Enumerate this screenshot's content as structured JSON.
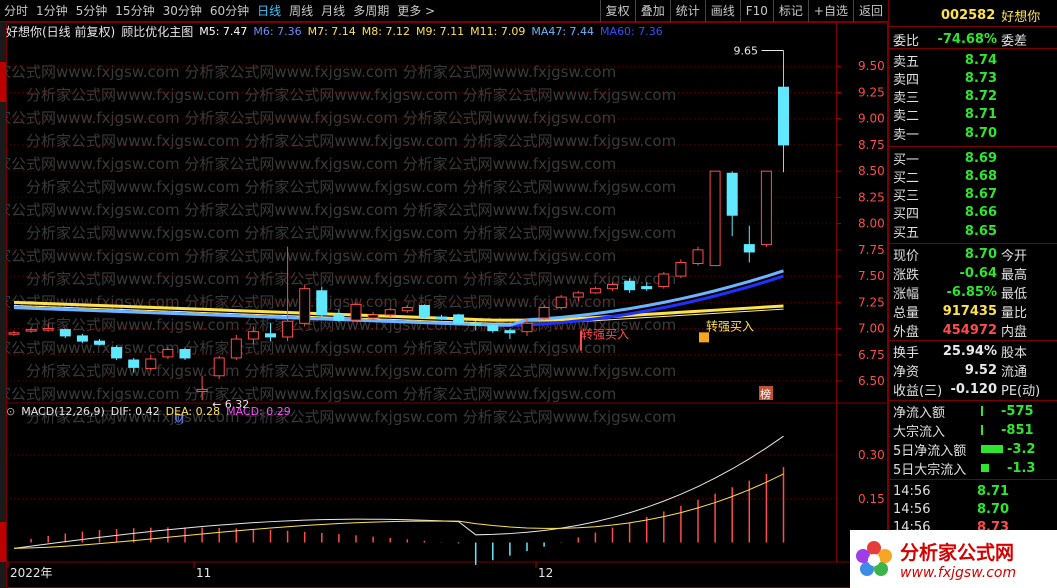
{
  "tabs": [
    "分时",
    "1分钟",
    "5分钟",
    "15分钟",
    "30分钟",
    "60分钟",
    "日线",
    "周线",
    "月线",
    "多周期",
    "更多 >"
  ],
  "active_tab": 6,
  "toolbar": [
    "复权",
    "叠加",
    "统计",
    "画线",
    "F10",
    "标记",
    "+自选",
    "返回"
  ],
  "chart_title": "好想你(日线 前复权)",
  "indicator_name": "顾比优化主图",
  "ma": [
    {
      "label": "M5: 7.47",
      "color": "#ffffff"
    },
    {
      "label": "M6: 7.36",
      "color": "#6b8cff"
    },
    {
      "label": "M7: 7.14",
      "color": "#ffe14b"
    },
    {
      "label": "M8: 7.12",
      "color": "#ffe14b"
    },
    {
      "label": "M9: 7.11",
      "color": "#ffe14b"
    },
    {
      "label": "M11: 7.09",
      "color": "#ffe14b"
    },
    {
      "label": "MA47: 7.44",
      "color": "#6bb6ff"
    },
    {
      "label": "MA60: 7.36",
      "color": "#3050ff"
    }
  ],
  "price_axis": [
    "9.50",
    "9.25",
    "9.00",
    "8.75",
    "8.50",
    "8.25",
    "8.00",
    "7.75",
    "7.50",
    "7.25",
    "7.00",
    "6.75",
    "6.50"
  ],
  "macd_axis": [
    "0.30",
    "0.15"
  ],
  "high_label": "9.65",
  "low_label": "6.32",
  "annotations": {
    "buy1": "转强买入",
    "buy2": "转强买入",
    "cai": "财",
    "bang": "榜"
  },
  "macd": {
    "name": "MACD(12,26,9)",
    "dif": "DIF: 0.42",
    "dea": "DEA: 0.28",
    "macd": "MACD: 0.29"
  },
  "x_labels": [
    "2022年",
    "11",
    "12"
  ],
  "chart_data": {
    "type": "candlestick",
    "candles": [
      {
        "o": 6.95,
        "c": 6.96,
        "h": 6.98,
        "l": 6.93
      },
      {
        "o": 6.98,
        "c": 6.99,
        "h": 7.01,
        "l": 6.96
      },
      {
        "o": 6.99,
        "c": 7.0,
        "h": 7.05,
        "l": 6.97
      },
      {
        "o": 6.99,
        "c": 6.93,
        "h": 7.0,
        "l": 6.91
      },
      {
        "o": 6.93,
        "c": 6.88,
        "h": 6.95,
        "l": 6.86
      },
      {
        "o": 6.88,
        "c": 6.85,
        "h": 6.9,
        "l": 6.84
      },
      {
        "o": 6.82,
        "c": 6.72,
        "h": 6.84,
        "l": 6.7
      },
      {
        "o": 6.7,
        "c": 6.63,
        "h": 6.72,
        "l": 6.58
      },
      {
        "o": 6.62,
        "c": 6.71,
        "h": 6.75,
        "l": 6.6
      },
      {
        "o": 6.73,
        "c": 6.8,
        "h": 6.82,
        "l": 6.71
      },
      {
        "o": 6.8,
        "c": 6.72,
        "h": 6.82,
        "l": 6.7
      },
      {
        "o": 6.4,
        "c": 6.42,
        "h": 6.55,
        "l": 6.32
      },
      {
        "o": 6.55,
        "c": 6.72,
        "h": 6.74,
        "l": 6.52
      },
      {
        "o": 6.72,
        "c": 6.9,
        "h": 6.94,
        "l": 6.7
      },
      {
        "o": 6.9,
        "c": 6.97,
        "h": 7.02,
        "l": 6.85
      },
      {
        "o": 6.95,
        "c": 6.92,
        "h": 7.05,
        "l": 6.88
      },
      {
        "o": 6.92,
        "c": 7.07,
        "h": 7.78,
        "l": 6.88
      },
      {
        "o": 7.05,
        "c": 7.38,
        "h": 7.42,
        "l": 7.02
      },
      {
        "o": 7.36,
        "c": 7.13,
        "h": 7.4,
        "l": 7.1
      },
      {
        "o": 7.13,
        "c": 7.08,
        "h": 7.18,
        "l": 7.06
      },
      {
        "o": 7.08,
        "c": 7.23,
        "h": 7.25,
        "l": 7.06
      },
      {
        "o": 7.1,
        "c": 7.13,
        "h": 7.16,
        "l": 7.08
      },
      {
        "o": 7.13,
        "c": 7.18,
        "h": 7.2,
        "l": 7.11
      },
      {
        "o": 7.17,
        "c": 7.2,
        "h": 7.22,
        "l": 7.15
      },
      {
        "o": 7.22,
        "c": 7.11,
        "h": 7.23,
        "l": 7.09
      },
      {
        "o": 7.11,
        "c": 7.1,
        "h": 7.13,
        "l": 7.08
      },
      {
        "o": 7.13,
        "c": 7.05,
        "h": 7.14,
        "l": 7.03
      },
      {
        "o": 7.05,
        "c": 7.04,
        "h": 7.08,
        "l": 6.98
      },
      {
        "o": 7.03,
        "c": 6.98,
        "h": 7.04,
        "l": 6.96
      },
      {
        "o": 6.98,
        "c": 6.96,
        "h": 7.0,
        "l": 6.9
      },
      {
        "o": 6.97,
        "c": 7.05,
        "h": 7.1,
        "l": 6.93
      },
      {
        "o": 7.1,
        "c": 7.2,
        "h": 7.22,
        "l": 7.08
      },
      {
        "o": 7.2,
        "c": 7.3,
        "h": 7.32,
        "l": 7.18
      },
      {
        "o": 7.3,
        "c": 7.34,
        "h": 7.36,
        "l": 7.26
      },
      {
        "o": 7.34,
        "c": 7.38,
        "h": 7.4,
        "l": 7.33
      },
      {
        "o": 7.38,
        "c": 7.42,
        "h": 7.44,
        "l": 7.36
      },
      {
        "o": 7.45,
        "c": 7.37,
        "h": 7.48,
        "l": 7.34
      },
      {
        "o": 7.4,
        "c": 7.38,
        "h": 7.44,
        "l": 7.36
      },
      {
        "o": 7.4,
        "c": 7.52,
        "h": 7.54,
        "l": 7.38
      },
      {
        "o": 7.5,
        "c": 7.63,
        "h": 7.66,
        "l": 7.48
      },
      {
        "o": 7.62,
        "c": 7.75,
        "h": 7.78,
        "l": 7.6
      },
      {
        "o": 7.6,
        "c": 8.5,
        "h": 8.5,
        "l": 7.6
      },
      {
        "o": 8.48,
        "c": 8.08,
        "h": 8.5,
        "l": 7.88
      },
      {
        "o": 7.8,
        "c": 7.73,
        "h": 7.98,
        "l": 7.63
      },
      {
        "o": 7.8,
        "c": 8.5,
        "h": 8.5,
        "l": 7.78
      },
      {
        "o": 9.3,
        "c": 8.75,
        "h": 9.65,
        "l": 8.49
      }
    ],
    "ma_series": [
      {
        "name": "M5",
        "values": []
      },
      {
        "name": "MA47",
        "color": "#6bb6ff"
      },
      {
        "name": "MA60",
        "color": "#3050ff"
      }
    ],
    "ylim": [
      6.32,
      9.65
    ]
  },
  "right_panel": {
    "code": "002582",
    "name": "好想你",
    "ratio_label": "委比",
    "ratio": "-74.68%",
    "diff_label": "委差",
    "sells": [
      {
        "l": "卖五",
        "v": "8.74"
      },
      {
        "l": "卖四",
        "v": "8.73"
      },
      {
        "l": "卖三",
        "v": "8.72"
      },
      {
        "l": "卖二",
        "v": "8.71"
      },
      {
        "l": "卖一",
        "v": "8.70"
      }
    ],
    "buys": [
      {
        "l": "买一",
        "v": "8.69"
      },
      {
        "l": "买二",
        "v": "8.68"
      },
      {
        "l": "买三",
        "v": "8.67"
      },
      {
        "l": "买四",
        "v": "8.66"
      },
      {
        "l": "买五",
        "v": "8.65"
      }
    ],
    "stats": [
      {
        "l": "现价",
        "v": "8.70",
        "r": "今开",
        "c": "green"
      },
      {
        "l": "涨跌",
        "v": "-0.64",
        "r": "最高",
        "c": "green"
      },
      {
        "l": "涨幅",
        "v": "-6.85%",
        "r": "最低",
        "c": "green"
      },
      {
        "l": "总量",
        "v": "917435",
        "r": "量比",
        "c": "yellow"
      },
      {
        "l": "外盘",
        "v": "454972",
        "r": "内盘",
        "c": "red"
      }
    ],
    "stats2": [
      {
        "l": "换手",
        "v": "25.94%",
        "r": "股本"
      },
      {
        "l": "净资",
        "v": "9.52",
        "r": "流通"
      },
      {
        "l": "收益(三)",
        "v": "-0.120",
        "r": "PE(动)"
      }
    ],
    "flow": [
      {
        "l": "净流入额",
        "v": "-575"
      },
      {
        "l": "大宗流入",
        "v": "-851"
      },
      {
        "l": "5日净流入额",
        "v": "-3.2"
      },
      {
        "l": "5日大宗流入",
        "v": "-1.3"
      }
    ],
    "ticks": [
      {
        "t": "14:56",
        "v": "8.71",
        "c": "green"
      },
      {
        "t": "14:56",
        "v": "8.70",
        "c": "green"
      },
      {
        "t": "14:56",
        "v": "8.73",
        "c": "red"
      }
    ]
  },
  "logo": {
    "cn": "分析家公式网",
    "url": "www.fxjgsw.com"
  },
  "watermark": "分析家公式网www.fxjgsw.com"
}
